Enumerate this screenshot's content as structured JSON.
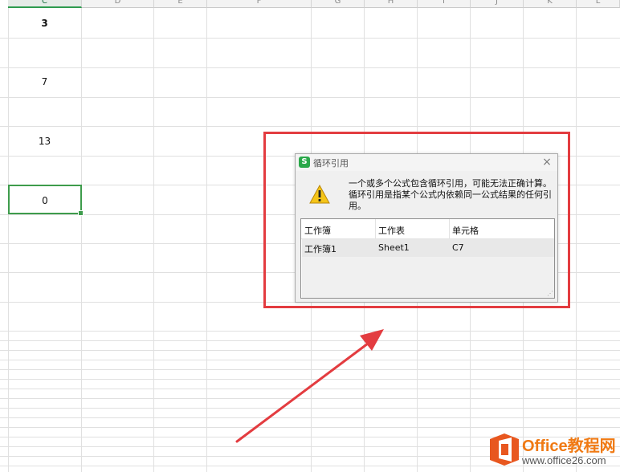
{
  "spreadsheet": {
    "columns": [
      "C",
      "D",
      "E",
      "F",
      "G",
      "H",
      "I",
      "J",
      "K",
      "L"
    ],
    "active_column": "C",
    "cells": [
      {
        "value": "3"
      },
      {
        "value": "7"
      },
      {
        "value": "13"
      },
      {
        "value": "0"
      }
    ],
    "selected_cell_value": "0"
  },
  "dialog": {
    "title": "循环引用",
    "app_icon_glyph": "S",
    "close_glyph": "×",
    "message_line1": "一个或多个公式包含循环引用，可能无法正确计算。",
    "message_line2": "循环引用是指某个公式内依赖同一公式结果的任何引",
    "message_line3": "用。",
    "table": {
      "headers": [
        "工作簿",
        "工作表",
        "单元格"
      ],
      "rows": [
        [
          "工作簿1",
          "Sheet1",
          "C7"
        ]
      ]
    },
    "icon": "warning-triangle-icon"
  },
  "annotation": {
    "highlight_color": "#e33c40",
    "arrow_color": "#e33c40"
  },
  "watermark": {
    "name": "Office教程网",
    "url": "www.office26.com",
    "accent_color": "#f07a14"
  }
}
